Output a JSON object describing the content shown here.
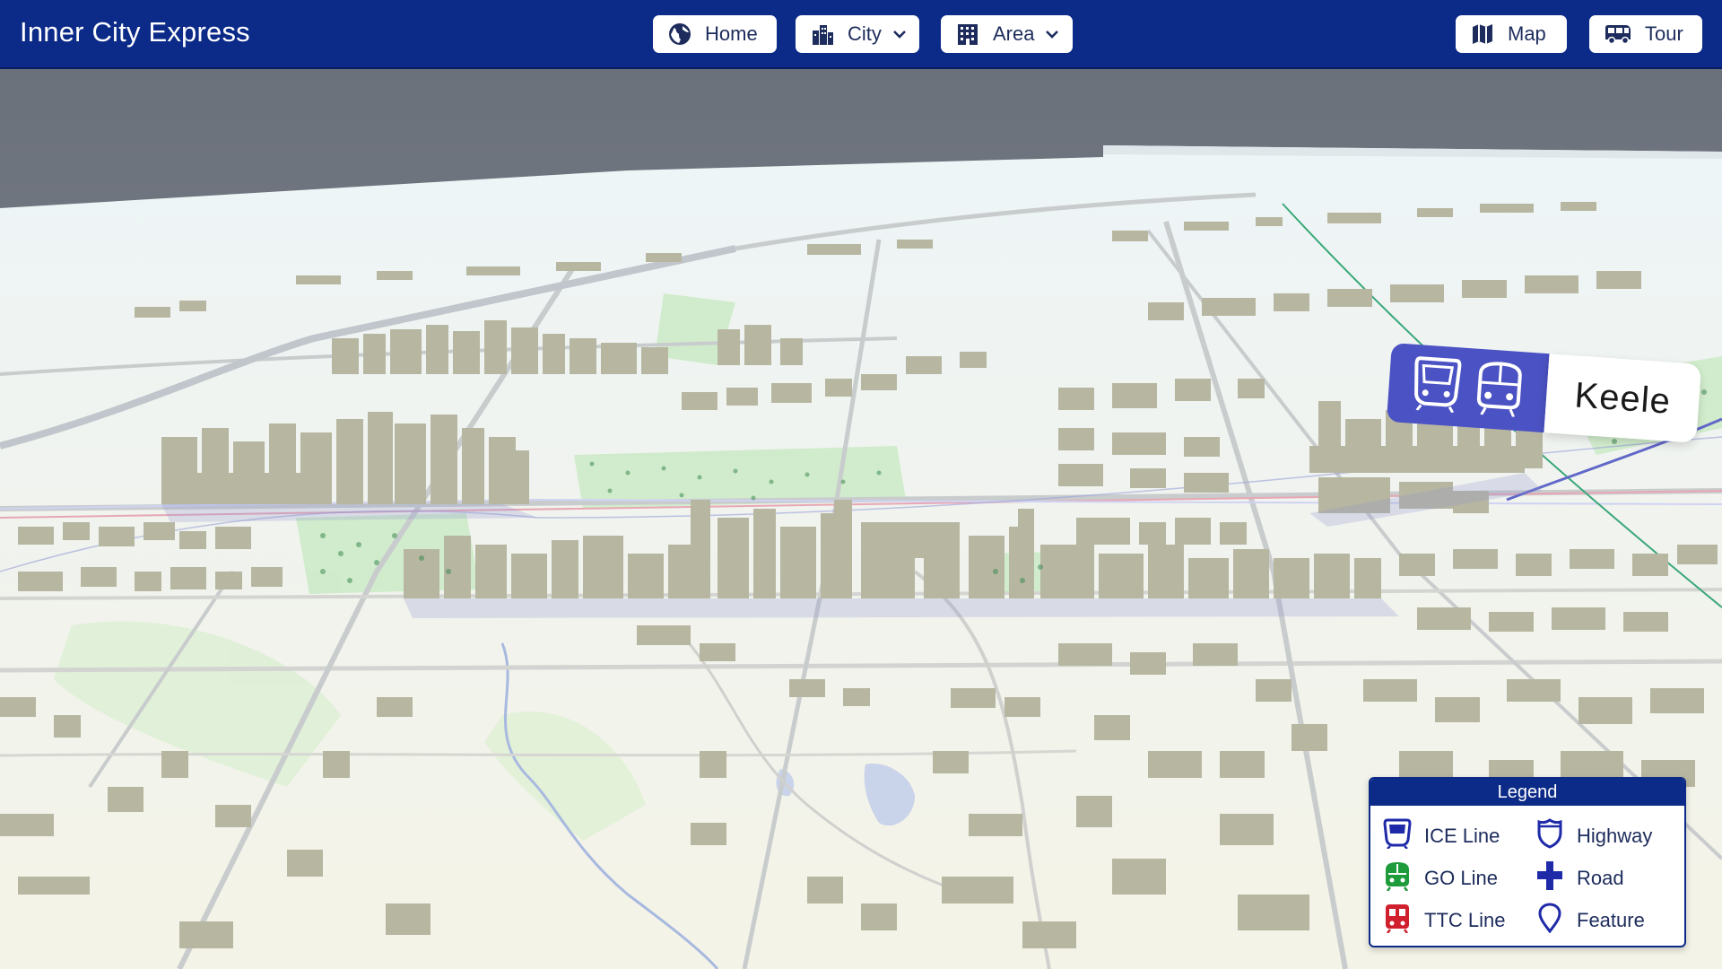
{
  "app": {
    "title": "Inner City Express"
  },
  "nav": {
    "home": {
      "label": "Home",
      "icon": "globe-icon"
    },
    "city": {
      "label": "City",
      "icon": "city-buildings-icon"
    },
    "area": {
      "label": "Area",
      "icon": "office-building-icon"
    },
    "map": {
      "label": "Map",
      "icon": "map-icon"
    },
    "tour": {
      "label": "Tour",
      "icon": "bus-icon"
    }
  },
  "station": {
    "name": "Keele",
    "icons": [
      "ice-train-icon",
      "go-train-icon"
    ]
  },
  "legend": {
    "title": "Legend",
    "items": [
      {
        "label": "ICE Line",
        "icon": "ice-train-icon",
        "color": "#1f2aa8"
      },
      {
        "label": "Highway",
        "icon": "highway-shield-icon",
        "color": "#1f2aa8"
      },
      {
        "label": "GO Line",
        "icon": "go-train-icon",
        "color": "#1e9b3a"
      },
      {
        "label": "Road",
        "icon": "road-cross-icon",
        "color": "#1f2aa8"
      },
      {
        "label": "TTC Line",
        "icon": "ttc-train-icon",
        "color": "#d0202e"
      },
      {
        "label": "Feature",
        "icon": "location-pin-icon",
        "color": "#1f2aa8"
      }
    ]
  },
  "colors": {
    "header": "#0c2a88",
    "station_badge": "#4b52c3",
    "ground": "#f3f2e8",
    "building": "#b7b7a1",
    "park": "#cfeccc",
    "water": "#c9d3ea"
  }
}
